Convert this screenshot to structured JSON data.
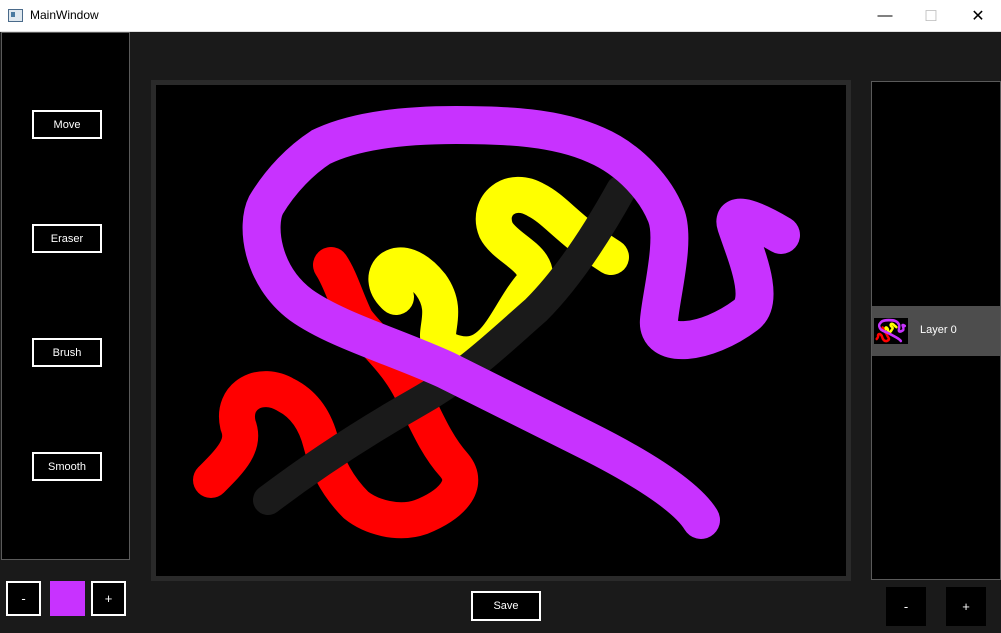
{
  "window": {
    "title": "MainWindow",
    "controls": {
      "minimize": "—",
      "maximize": "☐",
      "close": "✕"
    }
  },
  "tools": {
    "move": "Move",
    "eraser": "Eraser",
    "brush": "Brush",
    "smooth": "Smooth"
  },
  "brush_size": {
    "decrease": "-",
    "increase": "+"
  },
  "current_color": "#c832ff",
  "save_label": "Save",
  "layers": {
    "items": [
      {
        "label": "Layer 0",
        "selected": true
      }
    ],
    "remove": "-",
    "add": "+"
  },
  "stroke_colors": {
    "purple": "#c832ff",
    "yellow": "#ffff00",
    "red": "#ff0000",
    "black": "#1a1a1a"
  },
  "icons": [
    "app-window-icon",
    "minimize-icon",
    "maximize-icon",
    "close-icon"
  ]
}
